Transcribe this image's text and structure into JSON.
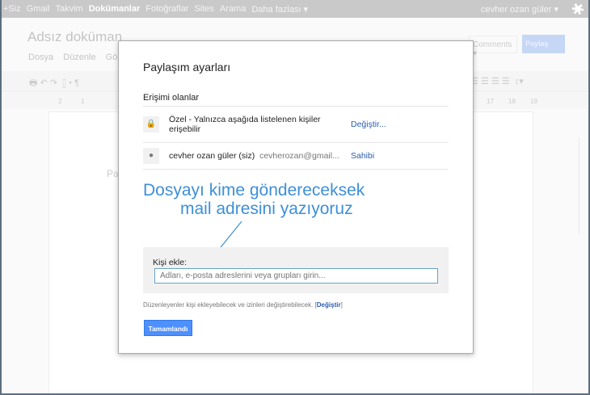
{
  "topbar": {
    "items": [
      "+Siz",
      "Gmail",
      "Takvim",
      "Dokümanlar",
      "Fotoğraflar",
      "Sites",
      "Arama",
      "Daha fazlası ▾"
    ],
    "active": "Dokümanlar",
    "user": "cevher ozan güler ▾"
  },
  "doc": {
    "title": "Adsız doküman",
    "menus": [
      "Dosya",
      "Düzenle",
      "Görü"
    ],
    "comments": "Comments ▾",
    "share": "Paylaş",
    "page_text": "Pay",
    "ruler": [
      "2",
      "1",
      "17",
      "18",
      "19"
    ]
  },
  "dialog": {
    "title": "Paylaşım ayarları",
    "section": "Erişimi olanlar",
    "rows": [
      {
        "icon": "lock-icon",
        "text": "Özel - Yalnızca aşağıda listelenen kişiler erişebilir",
        "action": "Değiştir..."
      },
      {
        "icon": "person-icon",
        "name": "cevher ozan güler (siz)",
        "email": "cevherozan@gmail...",
        "role": "Sahibi"
      }
    ],
    "annotation_line1": "Dosyayı kime göndereceksek",
    "annotation_line2": "mail adresini yazıyoruz",
    "add_label": "Kişi ekle:",
    "add_placeholder": "Adları, e-posta adreslerini veya grupları girin...",
    "footer_text": "Düzenleyenler kişi ekleyebilecek ve izinleri değiştirebilecek.",
    "footer_link": "Değiştir",
    "done": "Tamamlandı"
  },
  "colors": {
    "accent": "#4d90fe",
    "annotation": "#3d8fd8",
    "link": "#2a5db0"
  }
}
